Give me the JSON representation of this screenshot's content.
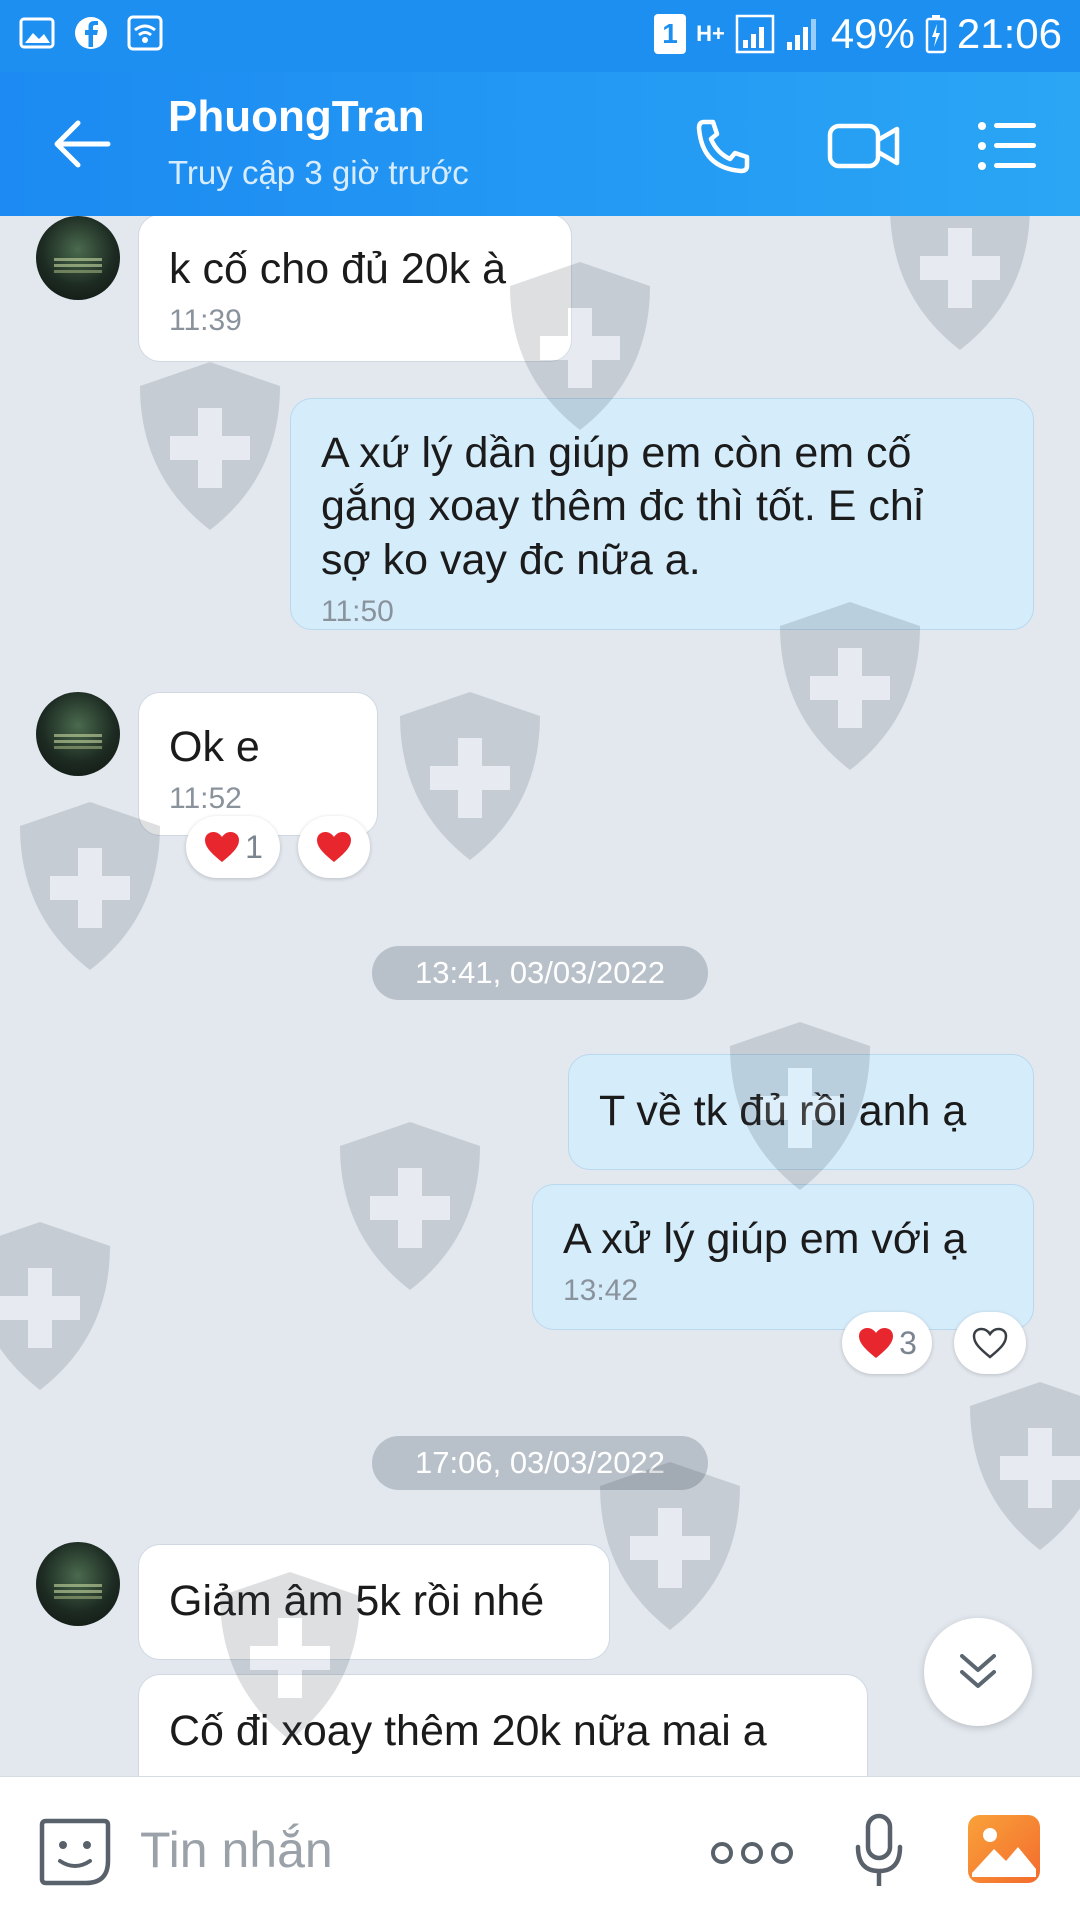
{
  "status_bar": {
    "sim_badge": "1",
    "network": "H+",
    "battery": "49%",
    "time": "21:06"
  },
  "header": {
    "contact_name": "PhuongTran",
    "last_seen": "Truy cập 3 giờ trước"
  },
  "messages": [
    {
      "side": "in",
      "text": "k cố cho đủ 20k à",
      "time": "11:39"
    },
    {
      "side": "out",
      "text_lines": [
        "A xứ lý dần giúp em còn em cố",
        "gắng xoay thêm đc thì tốt. E chỉ",
        "sợ ko vay đc nữa a."
      ],
      "time": "11:50"
    },
    {
      "side": "in",
      "text": "Ok e",
      "time": "11:52",
      "reaction_count": "1"
    },
    {
      "separator": "13:41, 03/03/2022"
    },
    {
      "side": "out",
      "text": "T về tk đủ rồi anh ạ"
    },
    {
      "side": "out",
      "text": "A xử lý giúp em với ạ",
      "time": "13:42",
      "reaction_count": "3"
    },
    {
      "separator": "17:06, 03/03/2022"
    },
    {
      "side": "in",
      "text": "Giảm âm 5k rồi nhé"
    },
    {
      "side": "in",
      "text": "Cố đi xoay thêm 20k nữa mai a"
    }
  ],
  "input": {
    "placeholder": "Tin nhắn"
  },
  "colors": {
    "header": "#1d8ff0",
    "outgoing_bubble": "#d5ecfb",
    "incoming_bubble": "#ffffff",
    "chat_background": "#e3e8ef",
    "heart": "#e8262e"
  },
  "icons": [
    "back-arrow-icon",
    "phone-icon",
    "video-call-icon",
    "menu-list-icon",
    "sticker-icon",
    "more-icon",
    "microphone-icon",
    "gallery-icon",
    "scroll-down-icon",
    "heart-icon"
  ]
}
